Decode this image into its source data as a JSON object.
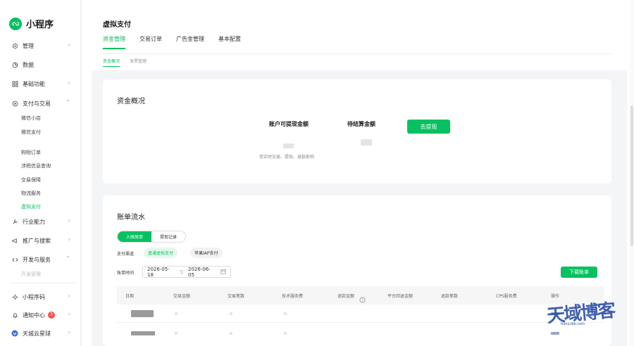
{
  "app": {
    "name": "小程序"
  },
  "sidebar": {
    "items": [
      {
        "label": "管理",
        "icon": "gear-icon",
        "chevron": "›"
      },
      {
        "label": "数据",
        "icon": "pie-icon",
        "chevron": ""
      },
      {
        "label": "基础功能",
        "icon": "grid-icon",
        "chevron": "›"
      },
      {
        "label": "支付与交易",
        "icon": "pay-icon",
        "chevron": "⌃"
      }
    ],
    "pay_sub": [
      "微信小店",
      "微信支付",
      "购物订单",
      "涉税信息查询",
      "交易保障",
      "物流服务",
      "虚拟支付"
    ],
    "items2": [
      {
        "label": "行业能力",
        "icon": "wrench-icon",
        "chevron": "›"
      },
      {
        "label": "推广与搜索",
        "icon": "megaphone-icon",
        "chevron": "›"
      },
      {
        "label": "开发与服务",
        "icon": "code-icon",
        "chevron": "⌃"
      }
    ],
    "dev_sub": [
      "开发管理"
    ],
    "bottom": [
      {
        "label": "小程序码",
        "icon": "sun-icon"
      },
      {
        "label": "通知中心",
        "icon": "bell-icon",
        "badge": "3"
      },
      {
        "label": "天城云星球",
        "icon": "avatar-icon"
      }
    ]
  },
  "header": {
    "title": "虚拟支付",
    "tabs": [
      "资金管理",
      "交易订单",
      "广告金管理",
      "基本配置"
    ],
    "subtabs": [
      "资金概况",
      "发票管理"
    ]
  },
  "funds": {
    "title": "资金概况",
    "withdrawable_label": "账户可提现金额",
    "pending_label": "待结算金额",
    "withdraw_button": "去提现",
    "note": "受实时交易、提现、退款影响"
  },
  "ledger": {
    "title": "账单流水",
    "segments": [
      "入账账单",
      "提现记录"
    ],
    "channel_label": "支付渠道",
    "channels": [
      "普通虚拟支付",
      "苹果IAP支付"
    ],
    "time_label": "账单时间",
    "date_start": "2026-05-18",
    "date_sep": "至",
    "date_end": "2026-06-05",
    "download_button": "下载账单",
    "columns": [
      "日期",
      "交易金额",
      "交易笔数",
      "技术服务费",
      "退款金额",
      "平台回退金额",
      "退款笔数",
      "CPS服务费",
      "操作"
    ]
  },
  "watermark": {
    "text": "天域博客",
    "sub": "tianyubk.com"
  },
  "colors": {
    "accent": "#07c160",
    "badge": "#fa5151"
  }
}
